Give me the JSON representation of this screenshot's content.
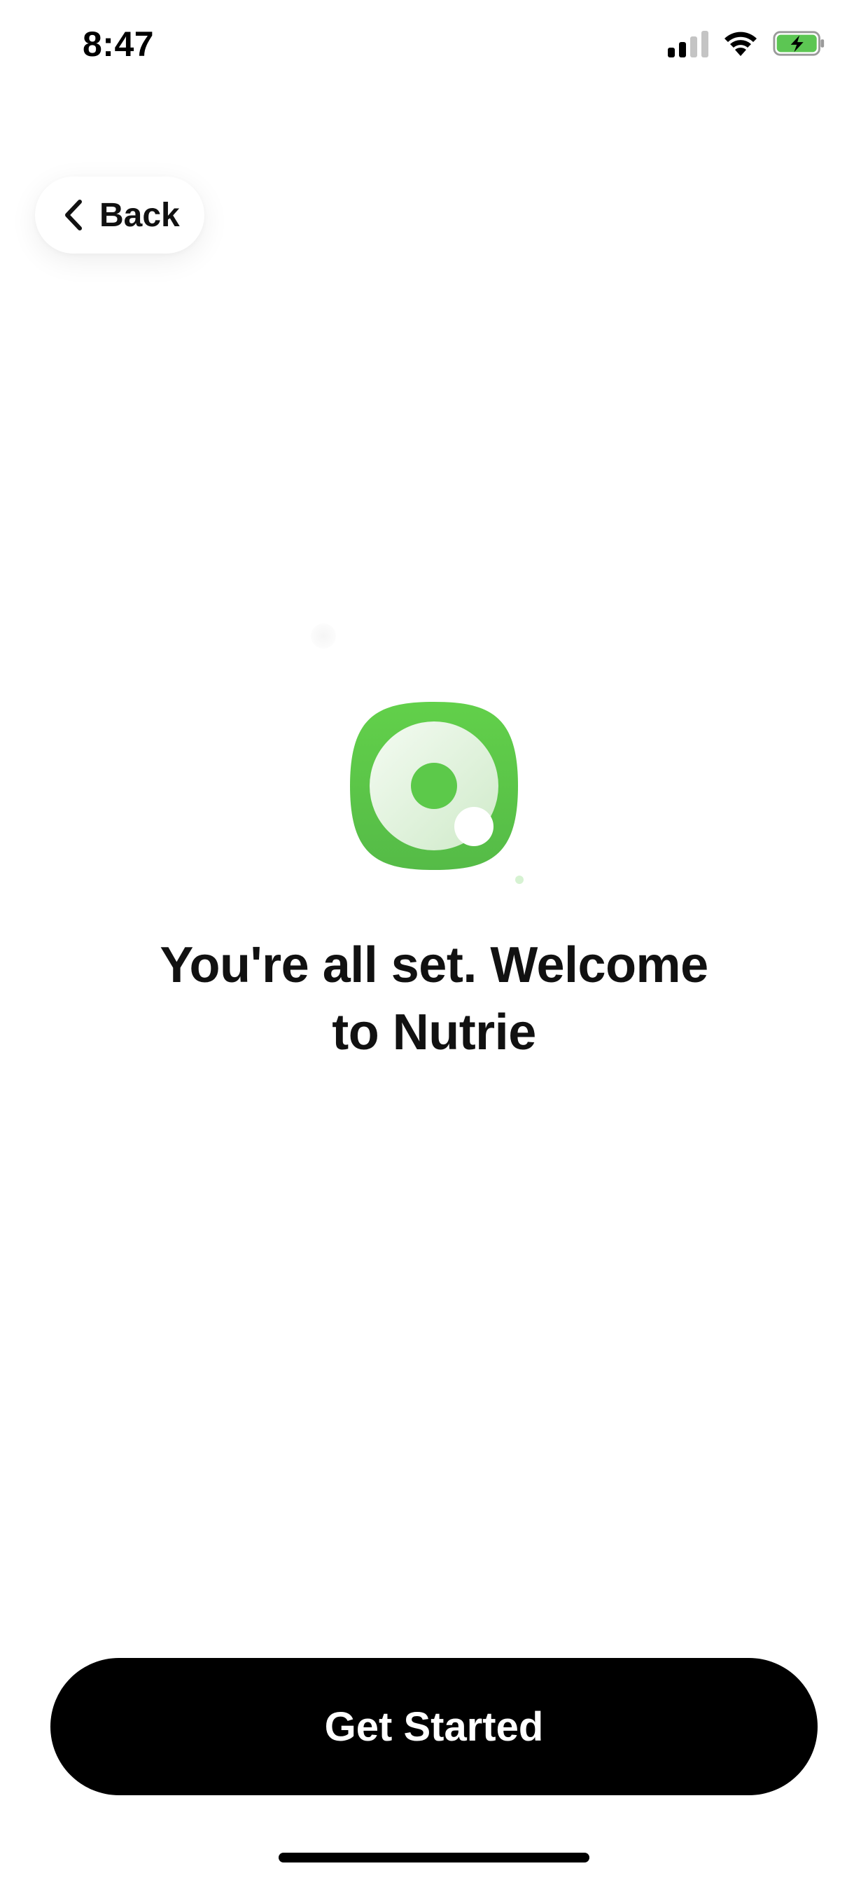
{
  "status_bar": {
    "time": "8:47",
    "icons": [
      "cellular-signal-icon",
      "wifi-icon",
      "battery-charging-icon"
    ],
    "battery_color": "#5cc653"
  },
  "nav": {
    "back_label": "Back",
    "back_icon": "chevron-left-icon"
  },
  "logo": {
    "icon": "nutrie-logo-icon",
    "primary_color": "#5cc94a"
  },
  "headline": {
    "line1": "You're all set. Welcome",
    "line2": "to Nutrie"
  },
  "cta": {
    "label": "Get Started",
    "background": "#000000",
    "text_color": "#ffffff"
  }
}
